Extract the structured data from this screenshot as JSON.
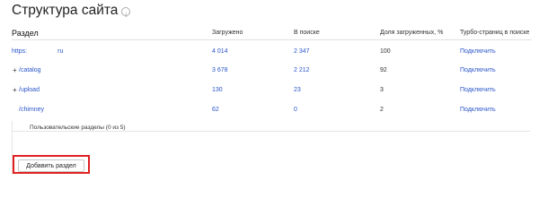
{
  "page": {
    "title": "Структура сайта"
  },
  "table": {
    "columns": [
      "Раздел",
      "Загружено",
      "В поиске",
      "Доля загруженных, %",
      "Турбо-страниц в поиске"
    ],
    "rows": [
      {
        "expander": "",
        "path_prefix": "https:",
        "path_suffix": "ru",
        "loaded": "4 014",
        "in_search": "2 347",
        "share": "100",
        "turbo": "Подключить"
      },
      {
        "expander": "+",
        "path_prefix": "/catalog",
        "path_suffix": "",
        "loaded": "3 678",
        "in_search": "2 212",
        "share": "92",
        "turbo": "Подключить"
      },
      {
        "expander": "+",
        "path_prefix": "/upload",
        "path_suffix": "",
        "loaded": "130",
        "in_search": "23",
        "share": "3",
        "turbo": "Подключить"
      },
      {
        "expander": "",
        "path_prefix": "/chimney",
        "path_suffix": "",
        "loaded": "62",
        "in_search": "0",
        "share": "2",
        "turbo": "Подключить"
      }
    ]
  },
  "custom_sections": {
    "legend": "Пользовательские разделы (0 из 5)",
    "add_button_label": "Добавить раздел"
  },
  "colors": {
    "link": "#2a55c9",
    "highlight_border": "#e02020"
  }
}
